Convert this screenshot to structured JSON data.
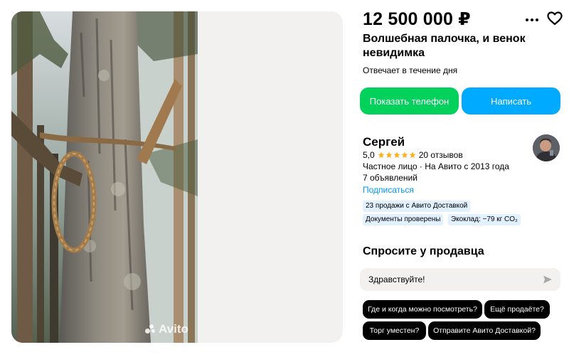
{
  "listing": {
    "price": "12 500 000 ₽",
    "title": "Волшебная палочка, и венок невидимка",
    "responds": "Отвечает в течение дня"
  },
  "watermark": "Avito",
  "actions": {
    "phone_label": "Показать телефон",
    "write_label": "Написать"
  },
  "seller": {
    "name": "Сергей",
    "rating_value": "5,0",
    "rating_stars": 5,
    "reviews": "20 отзывов",
    "type_since": "Частное лицо · На Авито с 2013 года",
    "listings": "7 объявлений",
    "subscribe_label": "Подписаться",
    "badges": [
      "23 продажи с Авито Доставкой",
      "Документы проверены",
      "Экоклад: −79 кг CO₂"
    ]
  },
  "ask": {
    "title": "Спросите у продавца",
    "input_value": "Здравствуйте!",
    "quick_questions": [
      "Где и когда можно посмотреть?",
      "Ещё продаёте?",
      "Торг уместен?",
      "Отправите Авито Доставкой?"
    ]
  },
  "icons": {
    "more": "more-dots-icon",
    "favorite": "heart-icon",
    "send": "send-icon",
    "star": "star-icon"
  },
  "colors": {
    "phone_button": "#02d15c",
    "write_button": "#00aaff",
    "star": "#ffb021",
    "link": "#0099f7",
    "badge_bg": "#e1f1ff",
    "chip_bg": "#000000"
  }
}
